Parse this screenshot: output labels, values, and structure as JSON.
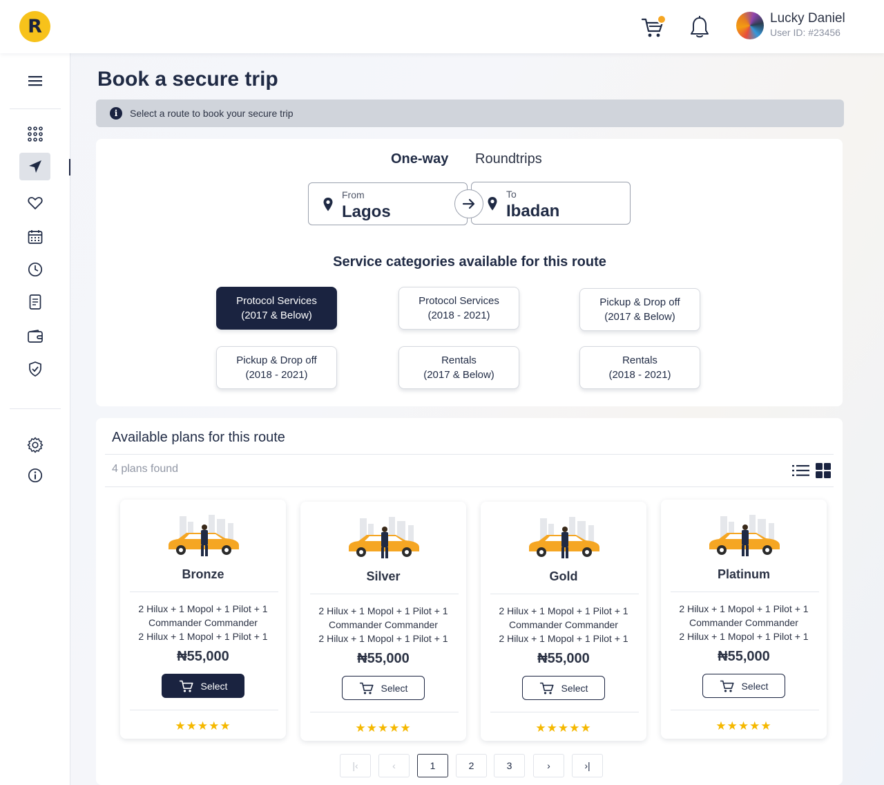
{
  "app": {
    "logo_letter": "R",
    "accent": "#f7c21b",
    "primary": "#1a2340"
  },
  "header": {
    "cart_icon": "shopping-cart-icon",
    "notification_icon": "bell-icon",
    "user_name": "Lucky Daniel",
    "user_id": "User ID: #23456"
  },
  "sidebar": {
    "items": [
      {
        "name": "menu-icon"
      },
      {
        "name": "apps-grid-icon"
      },
      {
        "name": "navigation-arrow-icon",
        "active": true
      },
      {
        "name": "heart-icon"
      },
      {
        "name": "calendar-icon"
      },
      {
        "name": "clock-icon"
      },
      {
        "name": "document-icon"
      },
      {
        "name": "wallet-icon"
      },
      {
        "name": "shield-check-icon"
      },
      {
        "name": "settings-gear-icon"
      },
      {
        "name": "info-icon"
      }
    ]
  },
  "page": {
    "title": "Book a secure trip",
    "info_text": "Select a route to book your secure trip"
  },
  "trip": {
    "tabs": [
      "One-way",
      "Roundtrips"
    ],
    "active_tab": "One-way",
    "from_label": "From",
    "from_value": "Lagos",
    "to_label": "To",
    "to_value": "Ibadan"
  },
  "services": {
    "title": "Service categories available for this route",
    "items": [
      {
        "line1": "Protocol Services",
        "line2": "(2017 & Below)",
        "selected": true
      },
      {
        "line1": "Protocol Services",
        "line2": "(2018 - 2021)"
      },
      {
        "line1": "Pickup & Drop off",
        "line2": "(2017 & Below)"
      },
      {
        "line1": "Pickup & Drop off",
        "line2": "(2018 - 2021)"
      },
      {
        "line1": "Rentals",
        "line2": "(2017 & Below)"
      },
      {
        "line1": "Rentals",
        "line2": "(2018 - 2021)"
      }
    ]
  },
  "plans": {
    "title": "Available plans for this route",
    "count_text": "4 plans found",
    "items": [
      {
        "name": "Bronze",
        "desc1": "2 Hilux + 1 Mopol + 1 Pilot + 1",
        "desc2": "Commander Commander",
        "desc3": "2 Hilux + 1 Mopol + 1 Pilot + 1",
        "price": "₦55,000",
        "button": "Select",
        "stars": "★★★★★"
      },
      {
        "name": "Silver",
        "desc1": "2 Hilux + 1 Mopol + 1 Pilot + 1",
        "desc2": "Commander Commander",
        "desc3": "2 Hilux + 1 Mopol + 1 Pilot + 1",
        "price": "₦55,000",
        "button": "Select",
        "stars": "★★★★★"
      },
      {
        "name": "Gold",
        "desc1": "2 Hilux + 1 Mopol + 1 Pilot + 1",
        "desc2": "Commander Commander",
        "desc3": "2 Hilux + 1 Mopol + 1 Pilot + 1",
        "price": "₦55,000",
        "button": "Select",
        "stars": "★★★★★"
      },
      {
        "name": "Platinum",
        "desc1": "2 Hilux + 1 Mopol + 1 Pilot + 1",
        "desc2": "Commander Commander",
        "desc3": "2 Hilux + 1 Mopol + 1 Pilot + 1",
        "price": "₦55,000",
        "button": "Select",
        "stars": "★★★★★"
      }
    ]
  },
  "pagination": {
    "first": "|‹",
    "prev": "‹",
    "pages": [
      "1",
      "2",
      "3"
    ],
    "current": "1",
    "next": "›",
    "last": "›|"
  }
}
